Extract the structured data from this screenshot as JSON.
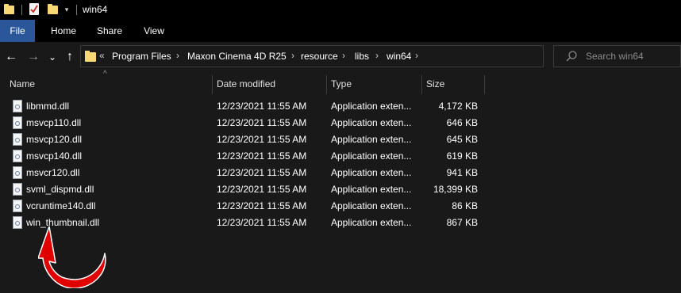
{
  "window": {
    "title": "win64"
  },
  "ribbon": {
    "tabs": [
      "File",
      "Home",
      "Share",
      "View"
    ]
  },
  "nav": {
    "back": "←",
    "forward": "→",
    "recent": "⌄",
    "up": "↑"
  },
  "address": {
    "overflow": "«",
    "separator": "›",
    "crumbs": [
      "Program Files",
      "Maxon Cinema 4D R25",
      "resource",
      "libs",
      "win64"
    ],
    "dropdown": "⌄",
    "refresh": "↻"
  },
  "search": {
    "placeholder": "Search win64"
  },
  "columns": {
    "name": "Name",
    "date": "Date modified",
    "type": "Type",
    "size": "Size"
  },
  "files": [
    {
      "name": "libmmd.dll",
      "date": "12/23/2021 11:55 AM",
      "type": "Application exten...",
      "size": "4,172 KB"
    },
    {
      "name": "msvcp110.dll",
      "date": "12/23/2021 11:55 AM",
      "type": "Application exten...",
      "size": "646 KB"
    },
    {
      "name": "msvcp120.dll",
      "date": "12/23/2021 11:55 AM",
      "type": "Application exten...",
      "size": "645 KB"
    },
    {
      "name": "msvcp140.dll",
      "date": "12/23/2021 11:55 AM",
      "type": "Application exten...",
      "size": "619 KB"
    },
    {
      "name": "msvcr120.dll",
      "date": "12/23/2021 11:55 AM",
      "type": "Application exten...",
      "size": "941 KB"
    },
    {
      "name": "svml_dispmd.dll",
      "date": "12/23/2021 11:55 AM",
      "type": "Application exten...",
      "size": "18,399 KB"
    },
    {
      "name": "vcruntime140.dll",
      "date": "12/23/2021 11:55 AM",
      "type": "Application exten...",
      "size": "86 KB"
    },
    {
      "name": "win_thumbnail.dll",
      "date": "12/23/2021 11:55 AM",
      "type": "Application exten...",
      "size": "867 KB"
    }
  ],
  "icons": {
    "folder": "folder-icon",
    "properties": "properties-icon",
    "dll": "dll-file-icon",
    "search": "search-icon",
    "annotation": "red-curved-arrow-icon"
  },
  "colors": {
    "background": "#191919",
    "titlebar": "#000000",
    "file_tab": "#2b579a",
    "folder": "#f8d775",
    "annotation_arrow": "#e00000"
  }
}
